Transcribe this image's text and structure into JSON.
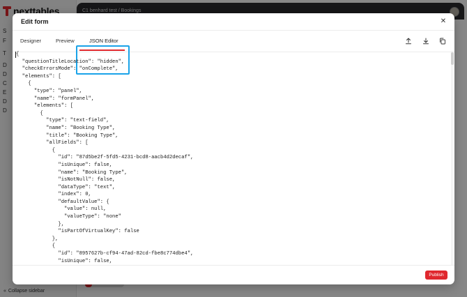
{
  "app": {
    "brand": "nexttables",
    "breadcrumb": "C1 benhard test / Bookings",
    "collapse_label": "Collapse sidebar",
    "sidebar_rows": [
      "S",
      "F",
      "T",
      "D",
      "D",
      "C",
      "E",
      "D",
      "D"
    ]
  },
  "modal": {
    "title": "Edit form",
    "tabs": [
      {
        "label": "Designer"
      },
      {
        "label": "Preview"
      },
      {
        "label": "JSON Editor",
        "active": true
      }
    ],
    "tools": [
      "upload-icon",
      "download-icon",
      "copy-icon"
    ],
    "publish_label": "Publish"
  },
  "colors": {
    "accent": "#e0282e",
    "highlight": "#1aa3e8"
  },
  "json_text": "{\n  \"questionTitleLocation\": \"hidden\",\n  \"checkErrorsMode\": \"onComplete\",\n  \"elements\": [\n    {\n      \"type\": \"panel\",\n      \"name\": \"formPanel\",\n      \"elements\": [\n        {\n          \"type\": \"text-field\",\n          \"name\": \"Booking Type\",\n          \"title\": \"Booking Type\",\n          \"allFields\": [\n            {\n              \"id\": \"87d5be2f-5fd5-4231-bcd8-aacb4d2decaf\",\n              \"isUnique\": false,\n              \"name\": \"Booking Type\",\n              \"isNotNull\": false,\n              \"dataType\": \"text\",\n              \"index\": 0,\n              \"defaultValue\": {\n                \"value\": null,\n                \"valueType\": \"none\"\n              },\n              \"isPartOfVirtualKey\": false\n            },\n            {\n              \"id\": \"8957627b-cf94-47ad-82cd-fbe8c774dbe4\",\n              \"isUnique\": false,"
}
